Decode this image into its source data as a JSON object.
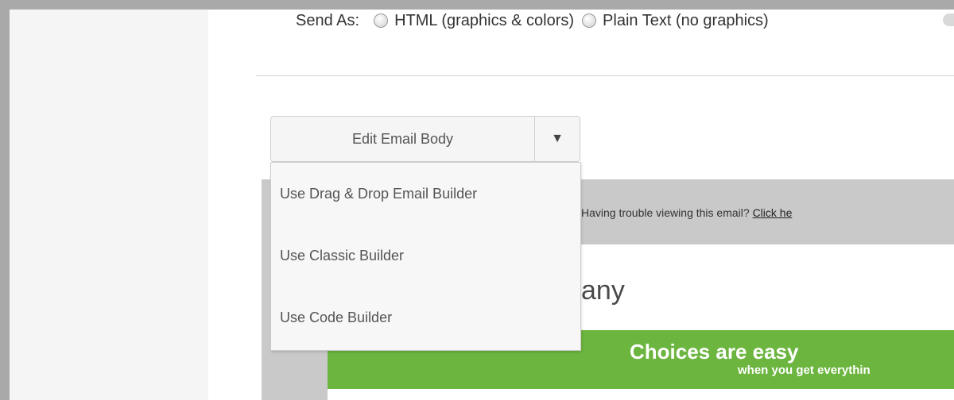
{
  "send_as": {
    "label": "Send As:",
    "options": [
      "HTML (graphics & colors)",
      "Plain Text (no graphics)"
    ]
  },
  "edit_email_body": {
    "label": "Edit Email Body",
    "caret": "▼",
    "menu_items": [
      "Use Drag & Drop Email Builder",
      "Use Classic Builder",
      "Use Code Builder"
    ]
  },
  "preview": {
    "trouble_text": "Having trouble viewing this email?",
    "trouble_link": "Click he",
    "company_fragment": "any",
    "banner_title": "Choices are easy",
    "banner_subtitle": "when you get everythin"
  },
  "colors": {
    "banner_green": "#6cb53f",
    "preview_gray": "#c9c9c9"
  }
}
